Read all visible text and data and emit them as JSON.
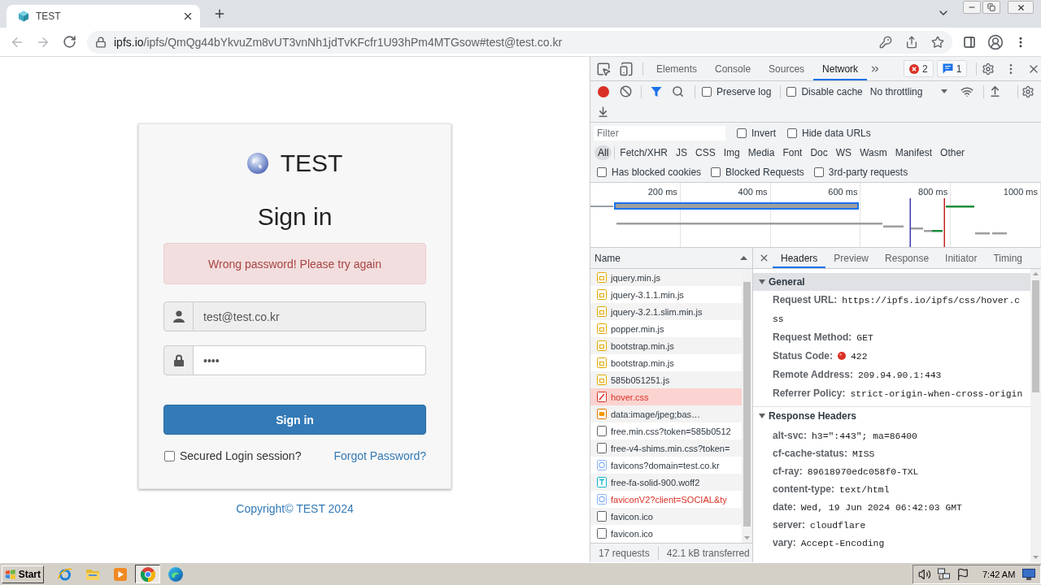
{
  "browser": {
    "tabs": [
      {
        "title": "TEST",
        "selected": true
      }
    ],
    "back": {
      "disabled": true
    },
    "forward": {
      "disabled": true
    },
    "url": {
      "host": "ipfs.io",
      "path": "/ipfs/QmQg44bYkvuZm8vUT3vnNh1jdTvKFcfr1U93hPm4MTGsow#test@test.co.kr"
    }
  },
  "login": {
    "brand": "TEST",
    "heading": "Sign in",
    "alert": "Wrong password! Please try again",
    "email": {
      "value": "test@test.co.kr",
      "readonly": true
    },
    "password": {
      "value": "••••",
      "readonly": false
    },
    "submit": "Sign in",
    "remember": {
      "label": "Secured Login session?",
      "checked": false
    },
    "forgot": "Forgot Password?",
    "copyright": "Copyright© TEST 2024"
  },
  "devtools": {
    "tabs": [
      {
        "label": "Elements",
        "selected": false
      },
      {
        "label": "Console",
        "selected": false
      },
      {
        "label": "Sources",
        "selected": false
      },
      {
        "label": "Network",
        "selected": true
      }
    ],
    "error_count": "2",
    "message_count": "1",
    "recording": true,
    "filter_active": true,
    "preserve_log": {
      "label": "Preserve log",
      "checked": false
    },
    "disable_cache": {
      "label": "Disable cache",
      "checked": false
    },
    "throttling": "No throttling",
    "filter": {
      "placeholder": "Filter",
      "invert": {
        "label": "Invert",
        "checked": false
      },
      "hide_data_urls": {
        "label": "Hide data URLs",
        "checked": false
      }
    },
    "types": [
      {
        "label": "All",
        "selected": true
      },
      {
        "label": "Fetch/XHR",
        "selected": false
      },
      {
        "label": "JS",
        "selected": false
      },
      {
        "label": "CSS",
        "selected": false
      },
      {
        "label": "Img",
        "selected": false
      },
      {
        "label": "Media",
        "selected": false
      },
      {
        "label": "Font",
        "selected": false
      },
      {
        "label": "Doc",
        "selected": false
      },
      {
        "label": "WS",
        "selected": false
      },
      {
        "label": "Wasm",
        "selected": false
      },
      {
        "label": "Manifest",
        "selected": false
      },
      {
        "label": "Other",
        "selected": false
      }
    ],
    "extra_filters": [
      {
        "label": "Has blocked cookies",
        "checked": false
      },
      {
        "label": "Blocked Requests",
        "checked": false
      },
      {
        "label": "3rd-party requests",
        "checked": false
      }
    ],
    "timeline_ticks": [
      "200 ms",
      "400 ms",
      "600 ms",
      "800 ms",
      "1000 ms"
    ],
    "requests": {
      "column": "Name",
      "rows": [
        {
          "name": "jquery.min.js",
          "kind": "script",
          "error": false,
          "selected": false
        },
        {
          "name": "jquery-3.1.1.min.js",
          "kind": "script",
          "error": false,
          "selected": false
        },
        {
          "name": "jquery-3.2.1.slim.min.js",
          "kind": "script",
          "error": false,
          "selected": false
        },
        {
          "name": "popper.min.js",
          "kind": "script",
          "error": false,
          "selected": false
        },
        {
          "name": "bootstrap.min.js",
          "kind": "script",
          "error": false,
          "selected": false
        },
        {
          "name": "bootstrap.min.js",
          "kind": "script",
          "error": false,
          "selected": false
        },
        {
          "name": "585b051251.js",
          "kind": "script",
          "error": false,
          "selected": false
        },
        {
          "name": "hover.css",
          "kind": "stylesheet",
          "error": true,
          "selected": true
        },
        {
          "name": "data:image/jpeg;bas…",
          "kind": "image",
          "error": false,
          "selected": false
        },
        {
          "name": "free.min.css?token=585b0512",
          "kind": "other",
          "error": false,
          "selected": false
        },
        {
          "name": "free-v4-shims.min.css?token=",
          "kind": "other",
          "error": false,
          "selected": false
        },
        {
          "name": "favicons?domain=test.co.kr",
          "kind": "favicon",
          "error": false,
          "selected": false
        },
        {
          "name": "free-fa-solid-900.woff2",
          "kind": "font",
          "error": false,
          "selected": false
        },
        {
          "name": "faviconV2?client=SOCIAL&ty",
          "kind": "favicon",
          "error": true,
          "selected": false
        },
        {
          "name": "favicon.ico",
          "kind": "other",
          "error": false,
          "selected": false
        },
        {
          "name": "favicon.ico",
          "kind": "other",
          "error": false,
          "selected": false
        }
      ],
      "count": "17 requests",
      "transferred": "42.1 kB transferred"
    },
    "details": {
      "tabs": [
        {
          "label": "Headers",
          "selected": true
        },
        {
          "label": "Preview",
          "selected": false
        },
        {
          "label": "Response",
          "selected": false
        },
        {
          "label": "Initiator",
          "selected": false
        },
        {
          "label": "Timing",
          "selected": false
        }
      ],
      "sections": [
        {
          "title": "General",
          "expanded": true,
          "focused": true,
          "rows": [
            {
              "key": "Request URL:",
              "value": "https://ipfs.io/ipfs/css/hover.css",
              "kind": "plain"
            },
            {
              "key": "Request Method:",
              "value": "GET",
              "kind": "plain"
            },
            {
              "key": "Status Code:",
              "value": "422",
              "kind": "status"
            },
            {
              "key": "Remote Address:",
              "value": "209.94.90.1:443",
              "kind": "plain"
            },
            {
              "key": "Referrer Policy:",
              "value": "strict-origin-when-cross-origin",
              "kind": "plain"
            }
          ]
        },
        {
          "title": "Response Headers",
          "expanded": true,
          "focused": false,
          "rows": [
            {
              "key": "alt-svc:",
              "value": "h3=\":443\"; ma=86400",
              "kind": "plain"
            },
            {
              "key": "cf-cache-status:",
              "value": "MISS",
              "kind": "plain"
            },
            {
              "key": "cf-ray:",
              "value": "89618970edc058f0-TXL",
              "kind": "plain"
            },
            {
              "key": "content-type:",
              "value": "text/html",
              "kind": "plain"
            },
            {
              "key": "date:",
              "value": "Wed, 19 Jun 2024 06:42:03 GMT",
              "kind": "plain"
            },
            {
              "key": "server:",
              "value": "cloudflare",
              "kind": "plain"
            },
            {
              "key": "vary:",
              "value": "Accept-Encoding",
              "kind": "plain"
            }
          ]
        }
      ]
    }
  },
  "taskbar": {
    "start": "Start",
    "apps": [
      {
        "kind": "ie",
        "selected": false
      },
      {
        "kind": "folder",
        "selected": false
      },
      {
        "kind": "player",
        "selected": false
      },
      {
        "kind": "chrome",
        "selected": true
      },
      {
        "kind": "edge",
        "selected": false
      }
    ],
    "clock": "7:42 AM"
  }
}
